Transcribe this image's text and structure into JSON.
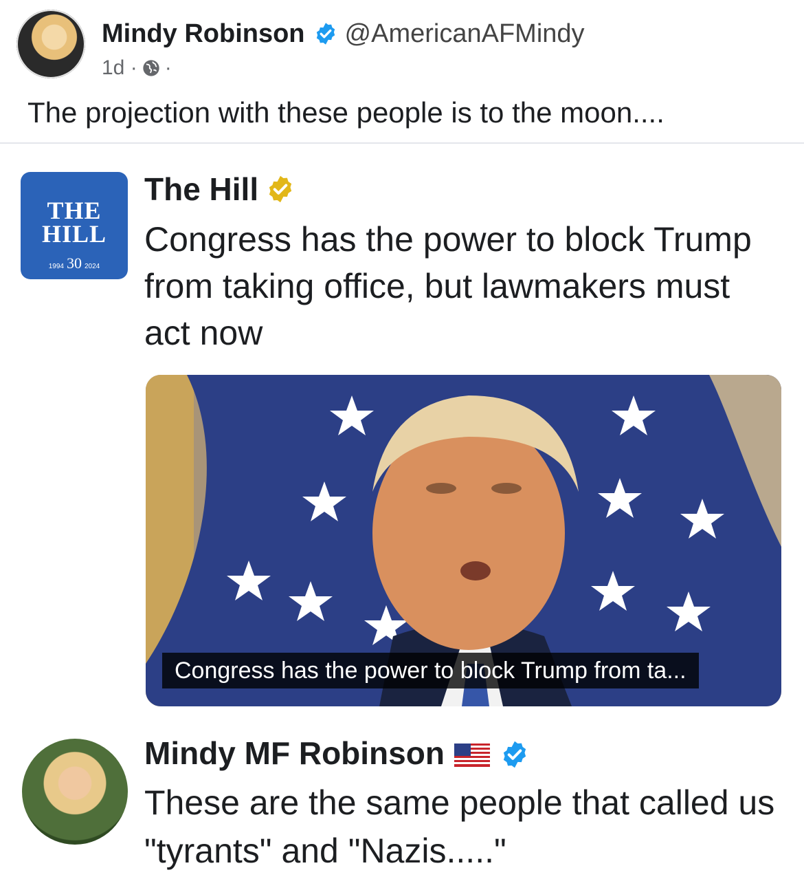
{
  "post": {
    "author_name": "Mindy Robinson",
    "handle": "@AmericanAFMindy",
    "time": "1d",
    "separator": "·",
    "text": "The projection with these people is to the moon...."
  },
  "embedded_tweet_1": {
    "logo_line1": "THE",
    "logo_line2": "HILL",
    "logo_year_start": "1994",
    "logo_anniversary": "30",
    "logo_year_end": "2024",
    "author_name": "The Hill",
    "text": "Congress has the power to block Trump from taking office, but lawmakers must act now",
    "media_caption": "Congress has the power to block Trump from ta..."
  },
  "embedded_tweet_2": {
    "author_name": "Mindy MF Robinson",
    "text": "These are the same people that called us \"tyrants\" and \"Nazis.....\""
  },
  "colors": {
    "verified_blue": "#1d9bf0",
    "verified_gold": "#e2b719",
    "hill_blue": "#2b63b8"
  },
  "icons": [
    "verified-badge-icon",
    "globe-icon",
    "gold-verified-icon",
    "us-flag-icon"
  ]
}
